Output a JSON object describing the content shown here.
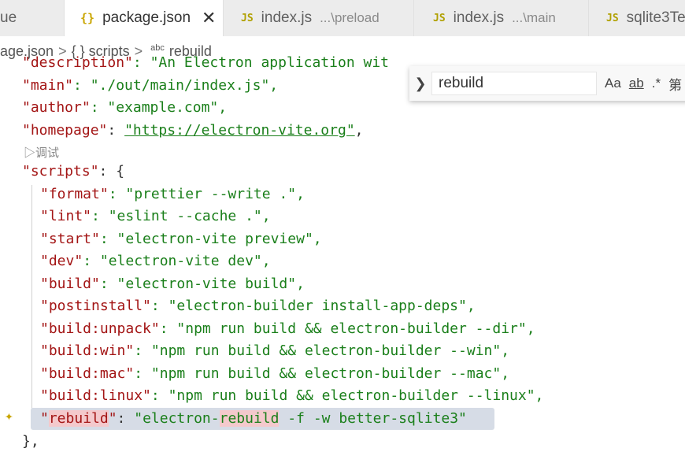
{
  "tabs": [
    {
      "label": "ue",
      "icon": "",
      "hint": ""
    },
    {
      "label": "package.json",
      "icon": "{}",
      "hint": "",
      "close": "✕"
    },
    {
      "label": "index.js",
      "icon": "JS",
      "hint": "...\\preload"
    },
    {
      "label": "index.js",
      "icon": "JS",
      "hint": "...\\main"
    },
    {
      "label": "sqlite3Te",
      "icon": "JS",
      "hint": ""
    }
  ],
  "breadcrumb": {
    "file": "age.json",
    "sep": ">",
    "scripts": "{ } scripts",
    "abc": "abc",
    "item": "rebuild"
  },
  "find": {
    "value": "rebuild",
    "match_case": "Aa",
    "whole_word": "ab",
    "regex": ".*",
    "extra": "第"
  },
  "code": {
    "l0": {
      "key": "\"description\"",
      "rest": ": \"An Electron application wit"
    },
    "l1": {
      "key": "\"main\"",
      "rest": ": \"./out/main/index.js\","
    },
    "l2": {
      "key": "\"author\"",
      "rest": ": \"example.com\","
    },
    "l3": {
      "key": "\"homepage\"",
      "colon": ": ",
      "url": "\"https://electron-vite.org\"",
      "tail": ","
    },
    "codelens": "▷调试",
    "l4": {
      "key": "\"scripts\"",
      "rest": ": {"
    },
    "l5": {
      "key": "\"format\"",
      "rest": ": \"prettier --write .\","
    },
    "l6": {
      "key": "\"lint\"",
      "rest": ": \"eslint --cache .\","
    },
    "l7": {
      "key": "\"start\"",
      "rest": ": \"electron-vite preview\","
    },
    "l8": {
      "key": "\"dev\"",
      "rest": ": \"electron-vite dev\","
    },
    "l9": {
      "key": "\"build\"",
      "rest": ": \"electron-vite build\","
    },
    "l10": {
      "key": "\"postinstall\"",
      "rest": ": \"electron-builder install-app-deps\","
    },
    "l11": {
      "key": "\"build:unpack\"",
      "rest": ": \"npm run build && electron-builder --dir\","
    },
    "l12": {
      "key": "\"build:win\"",
      "rest": ": \"npm run build && electron-builder --win\","
    },
    "l13": {
      "key": "\"build:mac\"",
      "rest": ": \"npm run build && electron-builder --mac\","
    },
    "l14": {
      "key": "\"build:linux\"",
      "rest": ": \"npm run build && electron-builder --linux\","
    },
    "l15": {
      "q1": "\"",
      "kw": "rebuild",
      "q2": "\"",
      "colon": ":",
      "v1": "\"electron-",
      "kw2": "rebuild",
      "v2": " -f -w better-sqlite3\""
    },
    "l16": {
      "text": "},"
    }
  }
}
